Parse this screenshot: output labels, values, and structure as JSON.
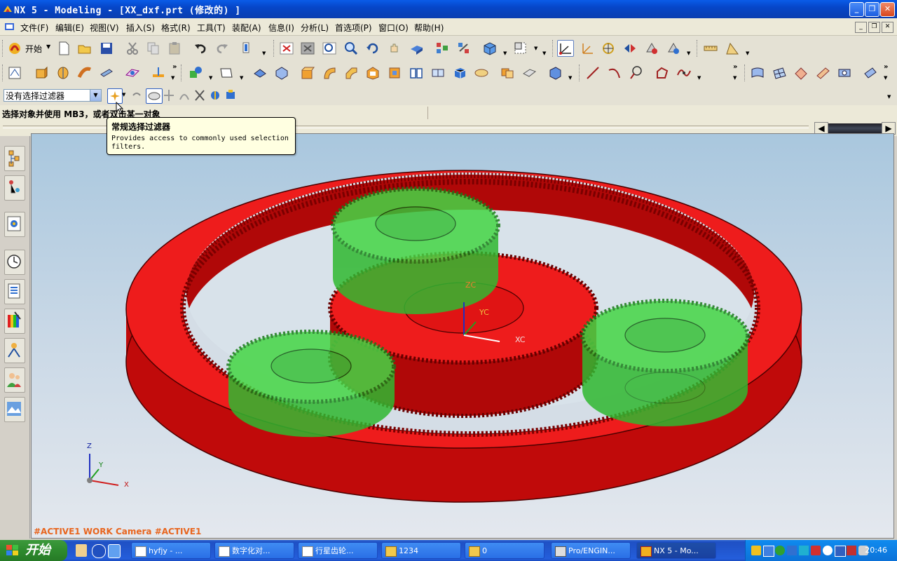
{
  "window": {
    "title": "NX 5 - Modeling - [XX_dxf.prt  (修改的) ]"
  },
  "menu": {
    "items": [
      "文件(F)",
      "编辑(E)",
      "视图(V)",
      "插入(S)",
      "格式(R)",
      "工具(T)",
      "装配(A)",
      "信息(I)",
      "分析(L)",
      "首选项(P)",
      "窗口(O)",
      "帮助(H)"
    ]
  },
  "toolbar": {
    "start_label": "开始"
  },
  "selection": {
    "filter_value": "没有选择过滤器"
  },
  "cue": {
    "text": "选择对象并使用 MB3，或者双击某一对象"
  },
  "tooltip": {
    "title": "常规选择过滤器",
    "body": "Provides access to commonly used selection filters."
  },
  "viewport": {
    "label": "#ACTIVE1 WORK Camera #ACTIVE1",
    "wcs": {
      "zc": "ZC",
      "yc": "YC",
      "xc": "XC"
    },
    "triad": {
      "z": "Z",
      "y": "Y",
      "x": "X"
    }
  },
  "taskbar": {
    "start": "开始",
    "tasks": [
      "hyfjy - ...",
      "数字化对...",
      "行星齿轮...",
      "1234",
      "0",
      "Pro/ENGIN...",
      "NX 5 - Mo..."
    ],
    "clock": "20:46"
  },
  "colors": {
    "ring_gear": "#ee1c1c",
    "planet_gear": "#3cd63c",
    "title_bar": "#0646c8",
    "viewport_label": "#e8651e"
  }
}
